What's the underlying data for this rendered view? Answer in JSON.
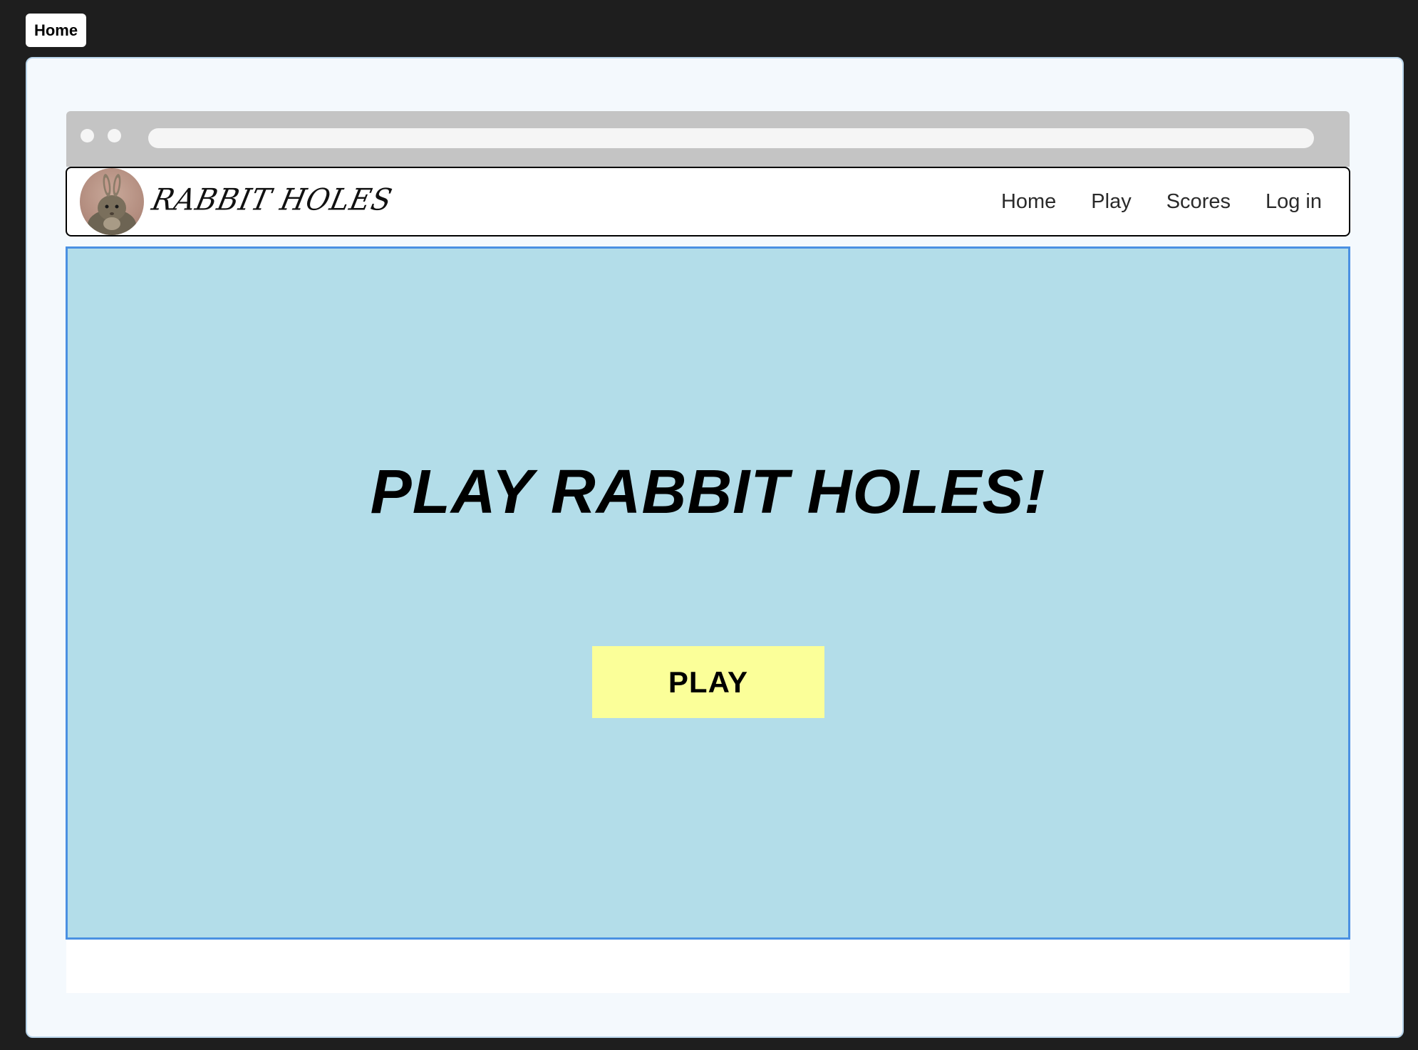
{
  "frame": {
    "tab_label": "Home"
  },
  "site": {
    "logo_text": "RABBIT HOLES",
    "nav": [
      {
        "label": "Home"
      },
      {
        "label": "Play"
      },
      {
        "label": "Scores"
      },
      {
        "label": "Log in"
      }
    ]
  },
  "hero": {
    "title": "PLAY RABBIT HOLES!",
    "play_button_label": "PLAY"
  },
  "colors": {
    "hero_background": "#b3dde9",
    "hero_border": "#4a90e2",
    "play_button": "#fbff99",
    "browser_chrome": "#c4c4c4",
    "outer_background": "#1e1e1e"
  },
  "icons": {
    "logo": "rabbit-avatar-icon"
  }
}
